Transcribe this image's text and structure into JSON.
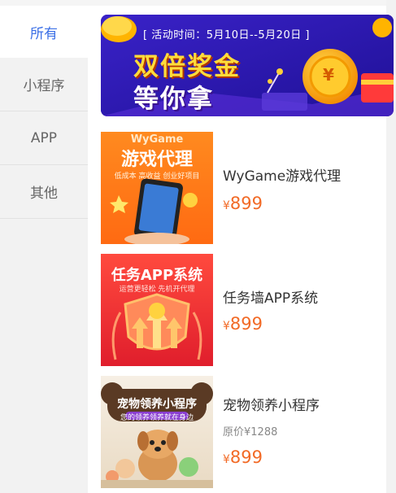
{
  "sidebar": {
    "items": [
      {
        "label": "所有",
        "active": true
      },
      {
        "label": "小程序",
        "active": false
      },
      {
        "label": "APP",
        "active": false
      },
      {
        "label": "其他",
        "active": false
      }
    ]
  },
  "banner": {
    "date": "[ 活动时间：5月10日--5月20日 ]",
    "line1": "双倍奖金",
    "line2": "等你拿",
    "coin_symbol": "¥"
  },
  "products": [
    {
      "name": "WyGame游戏代理",
      "price": "899",
      "currency": "¥",
      "thumb_brand": "WyGame",
      "thumb_title": "游戏代理",
      "thumb_sub": "低成本 高收益 创业好项目",
      "thumb_colors": [
        "#ff8a1f",
        "#ff6a12"
      ]
    },
    {
      "name": "任务墙APP系统",
      "price": "899",
      "currency": "¥",
      "thumb_title": "任务APP系统",
      "thumb_sub": "运营更轻松  先机开代理",
      "thumb_colors": [
        "#ff3b3b",
        "#e21e2e"
      ]
    },
    {
      "name": "宠物领养小程序",
      "original_price": "原价¥1288",
      "price": "899",
      "currency": "¥",
      "thumb_title": "宠物领养小程序",
      "thumb_sub": "您的领养领养就在身边",
      "thumb_colors": [
        "#f6efe4",
        "#e9dac3"
      ]
    }
  ],
  "colors": {
    "accent": "#3b6fe6",
    "price": "#f26a26",
    "sidebar_bg": "#f2f2f2"
  }
}
